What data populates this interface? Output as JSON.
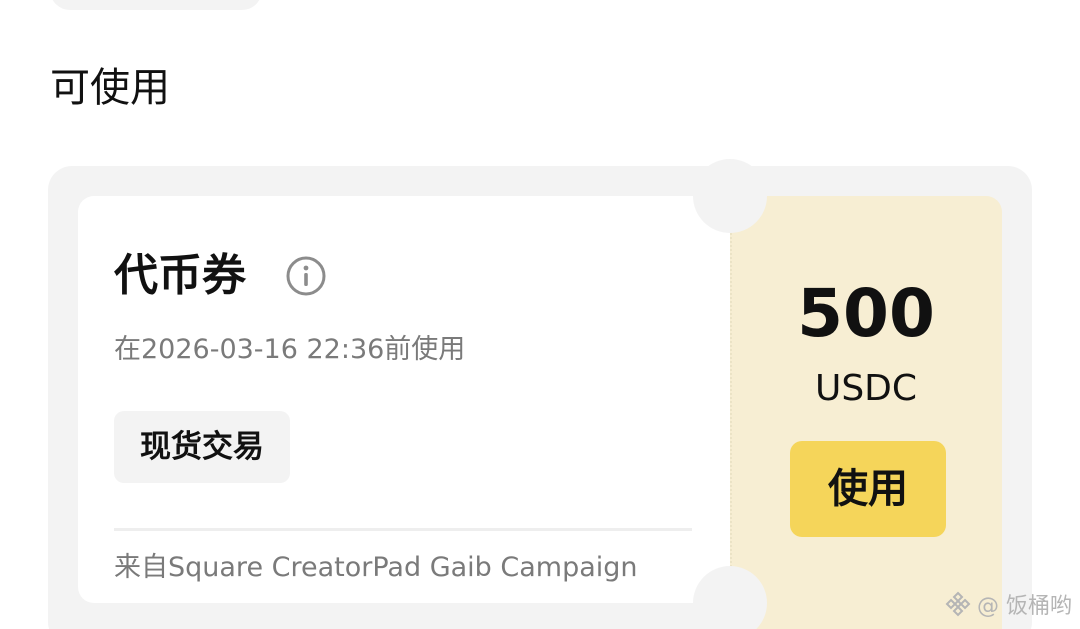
{
  "section": {
    "title": "可使用"
  },
  "coupon": {
    "name": "代币券",
    "info_icon": "info-circle-icon",
    "expiry": "在2026-03-16 22:36前使用",
    "tag": "现货交易",
    "source": "来自Square CreatorPad Gaib Campaign",
    "amount": "500",
    "currency": "USDC",
    "use_button_label": "使用",
    "colors": {
      "right_panel_bg": "#f7eed3",
      "use_button_bg": "#f5d55a",
      "card_bg": "#f3f3f3"
    }
  },
  "watermark": {
    "text": "@ 饭桶哟",
    "icon": "binance-logo-icon"
  }
}
